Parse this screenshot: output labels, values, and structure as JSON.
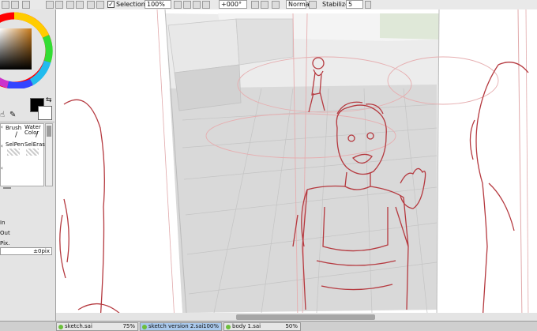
{
  "toolbar": {
    "selection_label": "Selection",
    "zoom_value": "100%",
    "rotation_value": "+000°",
    "blend_mode": "Normal",
    "stabilizer_label": "Stabilizer",
    "stabilizer_value": "5"
  },
  "left_panel": {
    "brush_tools": [
      {
        "label": "Brush"
      },
      {
        "label": "Water Color"
      },
      {
        "label": "SelPen"
      },
      {
        "label": "SelEras"
      }
    ],
    "nav_in": "In",
    "nav_out": "Out",
    "nav_pix": "Pix.",
    "offset_value": "±0pix"
  },
  "tabs": [
    {
      "name": "sketch.sai",
      "zoom": "75%"
    },
    {
      "name": "sketch version 2.sai",
      "zoom": "100%"
    },
    {
      "name": "body 1.sai",
      "zoom": "50%"
    }
  ],
  "colors": {
    "primary": "#000000",
    "secondary": "#ffffff",
    "sketch_line": "#b5393f",
    "floor_gray": "#d9d9d9",
    "active_tab": "#aac9ec"
  }
}
